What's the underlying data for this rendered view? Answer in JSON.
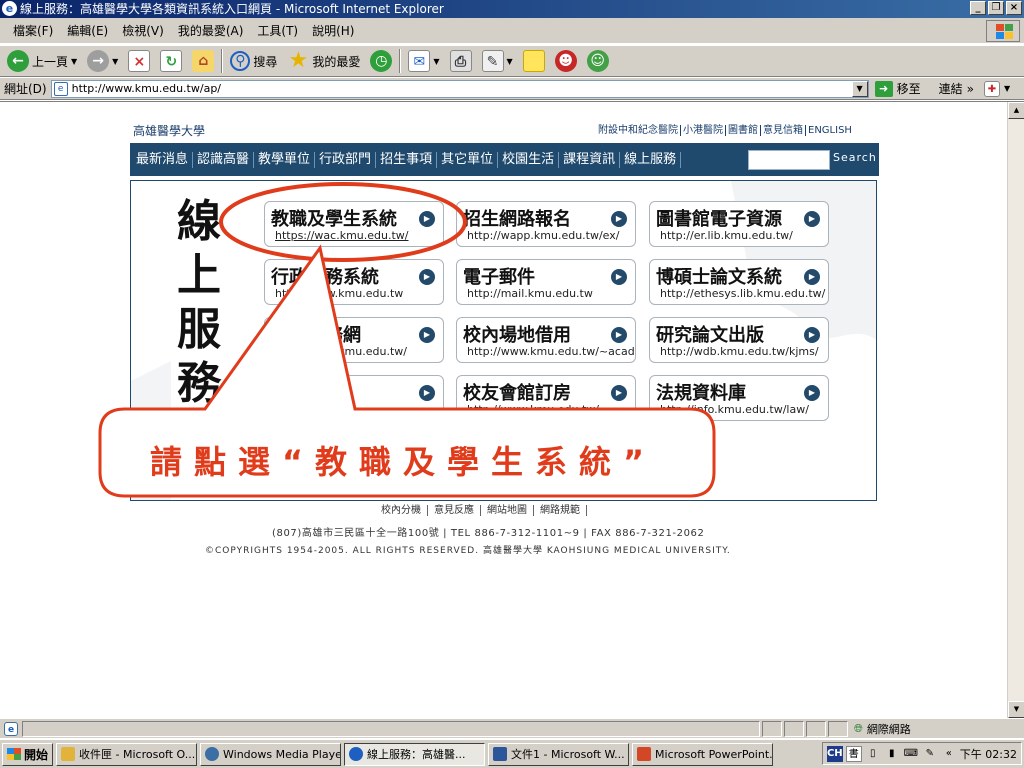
{
  "window": {
    "title": "線上服務：高雄醫學大學各類資訊系統入口網頁 - Microsoft Internet Explorer"
  },
  "menu": [
    "檔案(F)",
    "編輯(E)",
    "檢視(V)",
    "我的最愛(A)",
    "工具(T)",
    "說明(H)"
  ],
  "toolbar": {
    "back_label": "上一頁",
    "search_label": "搜尋",
    "favorites_label": "我的最愛"
  },
  "address": {
    "label": "網址(D)",
    "url": "http://www.kmu.edu.tw/ap/",
    "go_label": "移至",
    "links_label": "連結"
  },
  "site": {
    "name": "高雄醫學大學",
    "top_links": [
      "附設中和紀念醫院",
      "小港醫院",
      "圖書館",
      "意見信箱",
      "ENGLISH"
    ],
    "nav": [
      "最新消息",
      "認識高醫",
      "教學單位",
      "行政部門",
      "招生事項",
      "其它單位",
      "校園生活",
      "課程資訊",
      "線上服務"
    ],
    "search_button": "Search",
    "vertical_title": [
      "線",
      "上",
      "服",
      "務"
    ],
    "cards": [
      {
        "title": "教職及學生系統",
        "url": "https://wac.kmu.edu.tw/"
      },
      {
        "title": "招生網路報名",
        "url": "http://wapp.kmu.edu.tw/ex/"
      },
      {
        "title": "圖書館電子資源",
        "url": "http://er.lib.kmu.edu.tw/"
      },
      {
        "title": "行政事務系統",
        "url": "http://www.kmu.edu.tw"
      },
      {
        "title": "電子郵件",
        "url": "http://mail.kmu.edu.tw"
      },
      {
        "title": "博碩士論文系統",
        "url": "http://ethesys.lib.kmu.edu.tw/"
      },
      {
        "title": "教師服務網",
        "url": "http://www.kmu.edu.tw/"
      },
      {
        "title": "校內場地借用",
        "url": "http://www.kmu.edu.tw/~academic"
      },
      {
        "title": "研究論文出版",
        "url": "http://wdb.kmu.edu.tw/kjms/"
      },
      {
        "title": "",
        "url": ""
      },
      {
        "title": "校友會館訂房",
        "url": "http://www.kmu.edu.tw/"
      },
      {
        "title": "法規資料庫",
        "url": "http://info.kmu.edu.tw/law/"
      }
    ],
    "footer_links": [
      "校內分機",
      "意見反應",
      "網站地圖",
      "網路規範"
    ],
    "footer_address": "(807)高雄市三民區十全一路100號 | TEL 886-7-312-1101~9 | FAX 886-7-321-2062",
    "footer_copyright": "©COPYRIGHTS 1954-2005. ALL RIGHTS RESERVED. 高雄醫學大學 KAOHSIUNG MEDICAL UNIVERSITY."
  },
  "callout": {
    "text": "請點選“教職及學生系統”"
  },
  "status": {
    "zone": "網際網路"
  },
  "taskbar": {
    "start": "開始",
    "buttons": [
      {
        "label": "收件匣 - Microsoft O...",
        "color": "#e2b33b"
      },
      {
        "label": "Windows Media Player",
        "color": "#3a6ea5"
      },
      {
        "label": "線上服務：高雄醫...",
        "color": "#1e5fc2",
        "active": true
      },
      {
        "label": "文件1 - Microsoft W...",
        "color": "#2b579a"
      },
      {
        "label": "Microsoft PowerPoint...",
        "color": "#d24726"
      }
    ],
    "ime": "CH",
    "clock": "下午 02:32"
  },
  "colors": {
    "nav_bg": "#1f4a6e",
    "callout": "#e03c1c",
    "titlebar": "#0a246a"
  }
}
